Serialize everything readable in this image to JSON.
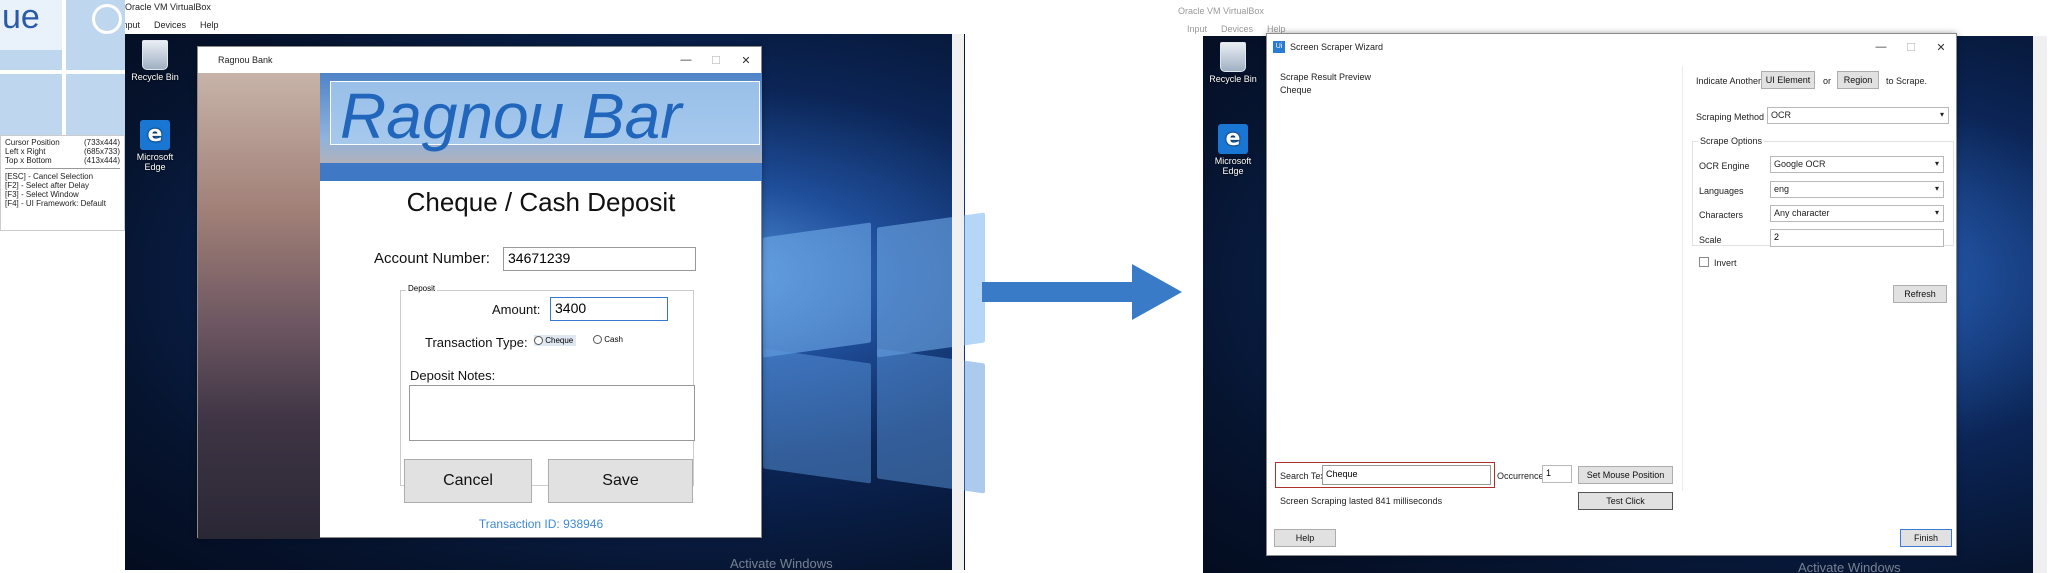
{
  "left": {
    "vbox_title": "Oracle VM VirtualBox",
    "vbox_menu": [
      "Input",
      "Devices",
      "Help"
    ],
    "zoom_fragment": "ue",
    "info": {
      "rows": [
        {
          "k": "Cursor Position",
          "v": "(733x444)"
        },
        {
          "k": "Left x Right",
          "v": "(685x733)"
        },
        {
          "k": "Top x Bottom",
          "v": "(413x444)"
        }
      ],
      "keys": [
        "[ESC] - Cancel Selection",
        "[F2] - Select after Delay",
        "[F3] - Select Window",
        "[F4] - UI Framework: Default"
      ]
    },
    "desktop": {
      "recycle": "Recycle Bin",
      "edge": "Microsoft Edge",
      "watermark": "Activate Windows"
    },
    "app": {
      "title": "Ragnou Bank",
      "banner": "Ragnou Bar",
      "heading": "Cheque / Cash Deposit",
      "account_label": "Account Number:",
      "account_value": "34671239",
      "deposit_group": "Deposit",
      "amount_label": "Amount:",
      "amount_value": "3400",
      "ttype_label": "Transaction Type:",
      "opt_cheque": "Cheque",
      "opt_cash": "Cash",
      "notes_label": "Deposit Notes:",
      "notes_value": "",
      "cancel": "Cancel",
      "save": "Save",
      "txn": "Transaction ID: 938946"
    }
  },
  "right": {
    "vbox_title": "Oracle VM VirtualBox",
    "vbox_menu": [
      "Input",
      "Devices",
      "Help"
    ],
    "desktop": {
      "recycle": "Recycle Bin",
      "edge": "Microsoft Edge",
      "watermark": "Activate Windows"
    },
    "wizard": {
      "title": "Screen Scraper Wizard",
      "preview_label": "Scrape Result Preview",
      "preview_text": "Cheque",
      "indicate": "Indicate Another",
      "ui_element": "UI Element",
      "or": "or",
      "region": "Region",
      "to_scrape": "to Scrape.",
      "method_label": "Scraping Method",
      "method_value": "OCR",
      "options_label": "Scrape Options",
      "engine_label": "OCR Engine",
      "engine_value": "Google OCR",
      "lang_label": "Languages",
      "lang_value": "eng",
      "chars_label": "Characters",
      "chars_value": "Any character",
      "scale_label": "Scale",
      "scale_value": "2",
      "invert": "Invert",
      "refresh": "Refresh",
      "search_label": "Search Text",
      "search_value": "Cheque",
      "occ_label": "Occurrence",
      "occ_value": "1",
      "set_mouse": "Set Mouse Position",
      "test_click": "Test Click",
      "status": "Screen Scraping lasted 841 milliseconds",
      "help": "Help",
      "finish": "Finish"
    }
  },
  "arrow_color": "#3a7bc8"
}
